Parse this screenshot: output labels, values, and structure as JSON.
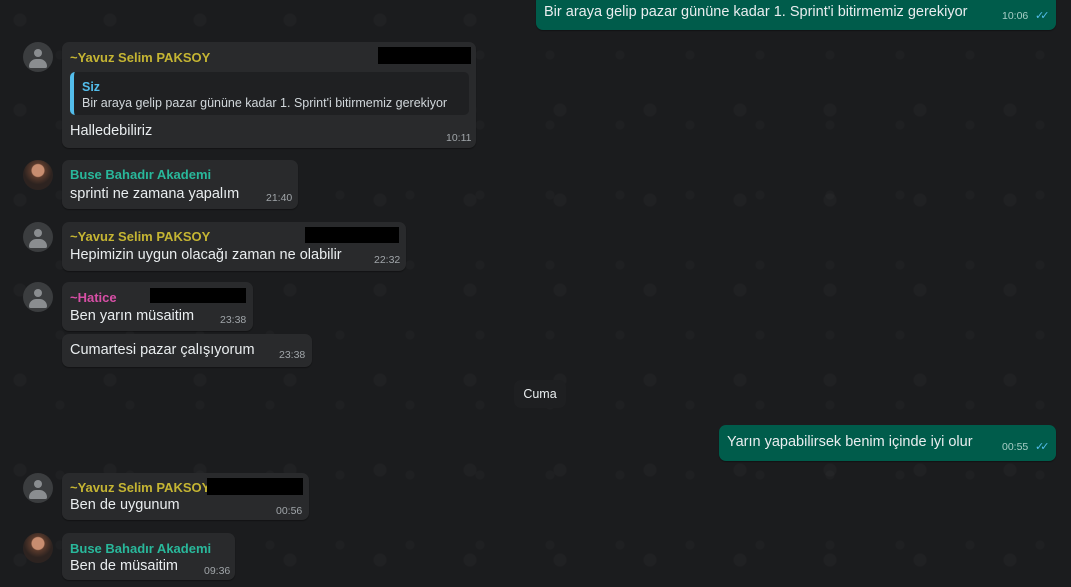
{
  "messages": {
    "m1": {
      "text": "Bir araya gelip pazar gününe kadar 1. Sprint'i bitirmemiz gerekiyor",
      "time": "10:06",
      "ticks": "✓✓"
    },
    "m2": {
      "sender": "~Yavuz Selim PAKSOY",
      "quote_title": "Siz",
      "quote_text": "Bir araya gelip pazar gününe kadar 1. Sprint'i bitirmemiz gerekiyor",
      "text": "Halledebiliriz",
      "time": "10:11"
    },
    "m3": {
      "sender": "Buse Bahadır Akademi",
      "text": "sprinti ne zamana yapalım",
      "time": "21:40"
    },
    "m4": {
      "sender": "~Yavuz Selim PAKSOY",
      "text": "Hepimizin uygun olacağı zaman ne olabilir",
      "time": "22:32"
    },
    "m5": {
      "sender": "~Hatice",
      "text": "Ben yarın müsaitim",
      "time": "23:38"
    },
    "m6": {
      "text": "Cumartesi pazar çalışıyorum",
      "time": "23:38"
    },
    "date_divider": "Cuma",
    "m7": {
      "text": "Yarın yapabilirsek benim içinde iyi olur",
      "time": "00:55",
      "ticks": "✓✓"
    },
    "m8": {
      "sender": "~Yavuz Selim PAKSOY",
      "text": "Ben de uygunum",
      "time": "00:56"
    },
    "m9": {
      "sender": "Buse Bahadır Akademi",
      "text": "Ben de müsaitim",
      "time": "09:36"
    }
  },
  "colors": {
    "background": "#1b1c1e",
    "incoming_bubble": "#292a2c",
    "outgoing_bubble": "#005c4b",
    "read_ticks": "#53bdeb",
    "sender_yavuz": "#c5b533",
    "sender_buse": "#29b89b",
    "sender_hatice": "#d74fa6"
  },
  "icons": {
    "default_avatar": "person-avatar-icon",
    "read_receipt": "double-check-icon"
  }
}
